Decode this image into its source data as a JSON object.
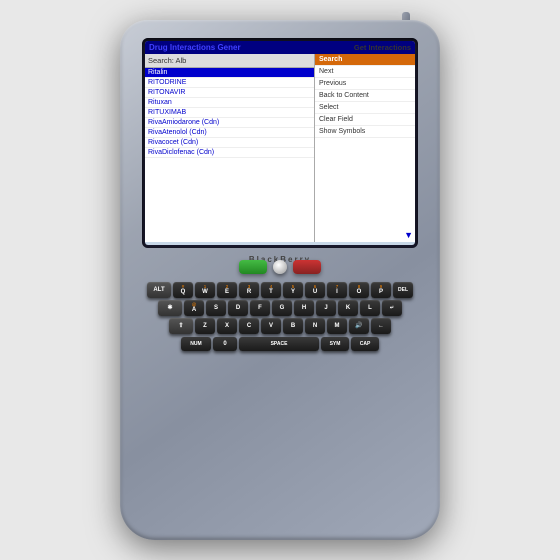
{
  "device": {
    "brand": "BlackBerry"
  },
  "screen": {
    "header_left": "Drug Interactions Gener",
    "header_right": "Get Interactions",
    "search_label": "Search: Alb"
  },
  "list_items": [
    {
      "label": "Ritalin",
      "selected": true
    },
    {
      "label": "RITODRINE",
      "selected": false
    },
    {
      "label": "RITONAVIR",
      "selected": false
    },
    {
      "label": "Rituxan",
      "selected": false
    },
    {
      "label": "RITUXIMAB",
      "selected": false
    },
    {
      "label": "RivaAmiodarone (Cdn)",
      "selected": false
    },
    {
      "label": "RivaAtenolol (Cdn)",
      "selected": false
    },
    {
      "label": "Rivacocet (Cdn)",
      "selected": false
    },
    {
      "label": "RivaDiclofenac (Cdn)",
      "selected": false
    }
  ],
  "menu_items": [
    {
      "label": "Search",
      "active": true
    },
    {
      "label": "Next",
      "active": false
    },
    {
      "label": "Previous",
      "active": false
    },
    {
      "label": "Back to Content",
      "active": false
    },
    {
      "label": "Select",
      "active": false
    },
    {
      "label": "Clear Field",
      "active": false
    },
    {
      "label": "Show Symbols",
      "active": false
    }
  ],
  "keyboard": {
    "row1": [
      "Q",
      "W",
      "E",
      "R",
      "T",
      "Y",
      "U",
      "I",
      "O",
      "P"
    ],
    "row1_sub": [
      "#",
      "1",
      "2",
      "3",
      "4",
      "5",
      "6",
      "7",
      "8",
      "9",
      "0"
    ],
    "row2": [
      "A",
      "S",
      "D",
      "F",
      "G",
      "H",
      "J",
      "K",
      "L"
    ],
    "row3": [
      "Z",
      "X",
      "C",
      "V",
      "B",
      "N",
      "M"
    ],
    "bottom": [
      "NUM",
      "0",
      "SPACE",
      "SYM",
      "CAP"
    ]
  },
  "nav_buttons": {
    "green": "Call",
    "red": "End",
    "trackball": "scroll"
  }
}
